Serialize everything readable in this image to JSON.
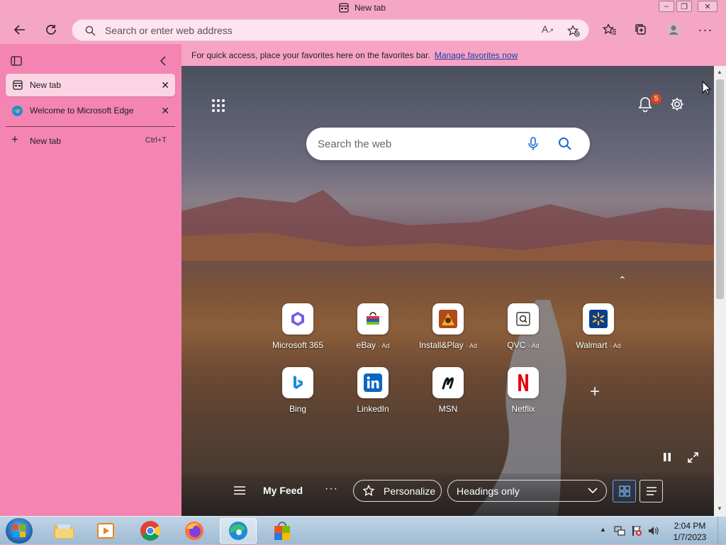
{
  "window": {
    "title": "New tab"
  },
  "address_bar": {
    "placeholder": "Search or enter web address"
  },
  "favorites_bar": {
    "message": "For quick access, place your favorites here on the favorites bar.",
    "link": "Manage favorites now"
  },
  "sidebar": {
    "tabs": [
      {
        "label": "New tab",
        "active": true
      },
      {
        "label": "Welcome to Microsoft Edge",
        "active": false
      }
    ],
    "new_tab": {
      "label": "New tab",
      "shortcut": "Ctrl+T"
    }
  },
  "newtab_page": {
    "search_placeholder": "Search the web",
    "notification_count": "5",
    "quick_links": [
      {
        "label": "Microsoft 365",
        "ad": ""
      },
      {
        "label": "eBay",
        "ad": "· Ad"
      },
      {
        "label": "Install&Play",
        "ad": "· Ad"
      },
      {
        "label": "QVC",
        "ad": "· Ad"
      },
      {
        "label": "Walmart",
        "ad": "· Ad"
      },
      {
        "label": "Bing",
        "ad": ""
      },
      {
        "label": "LinkedIn",
        "ad": ""
      },
      {
        "label": "MSN",
        "ad": ""
      },
      {
        "label": "Netflix",
        "ad": ""
      }
    ],
    "feed": {
      "title": "My Feed",
      "personalize": "Personalize",
      "layout_select": "Headings only"
    }
  },
  "taskbar": {
    "time": "2:04 PM",
    "date": "1/7/2023"
  },
  "colors": {
    "chrome_pink": "#f5a6c4",
    "sidebar_pink": "#f485b3",
    "accent": "#1a3ea5"
  }
}
